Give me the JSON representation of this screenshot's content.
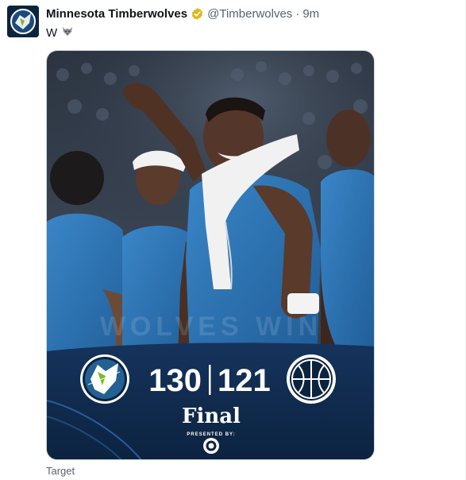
{
  "post": {
    "author_name": "Minnesota Timberwolves",
    "handle": "@Timberwolves",
    "separator": "·",
    "time": "9m",
    "text": "W",
    "text_emoji": "wolf-icon"
  },
  "graphic": {
    "home_score": "130",
    "away_score": "121",
    "status": "Final",
    "sponsor_label": "PRESENTED BY:",
    "sponsor_logo": "target-logo",
    "home_logo": "timberwolves-logo",
    "away_logo": "wizards-logo",
    "watermark": "WOLVES WIN"
  },
  "media_caption": "Target",
  "colors": {
    "navy": "#0c2340",
    "jersey_blue": "#2b6cb0",
    "verified_gold": "#e2b719",
    "muted_text": "#536471"
  }
}
